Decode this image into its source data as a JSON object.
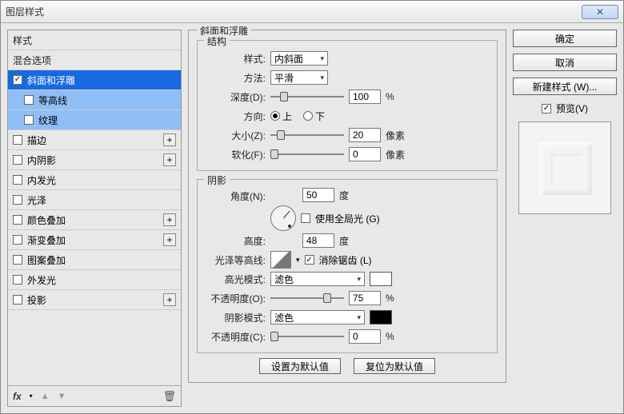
{
  "dialog": {
    "title": "图层样式"
  },
  "left": {
    "header_styles": "样式",
    "header_blending": "混合选项",
    "items": [
      {
        "label": "斜面和浮雕",
        "checked": true,
        "selected": true,
        "plus": false
      },
      {
        "label": "等高线",
        "sub": true,
        "plus": false
      },
      {
        "label": "纹理",
        "sub": true,
        "plus": false
      },
      {
        "label": "描边",
        "plus": true
      },
      {
        "label": "内阴影",
        "plus": true
      },
      {
        "label": "内发光",
        "plus": false
      },
      {
        "label": "光泽",
        "plus": false
      },
      {
        "label": "颜色叠加",
        "plus": true
      },
      {
        "label": "渐变叠加",
        "plus": true
      },
      {
        "label": "图案叠加",
        "plus": false
      },
      {
        "label": "外发光",
        "plus": false
      },
      {
        "label": "投影",
        "plus": true
      }
    ],
    "fx": "fx"
  },
  "main": {
    "group_title": "斜面和浮雕",
    "structure": {
      "legend": "结构",
      "style_label": "样式:",
      "style_value": "内斜面",
      "technique_label": "方法:",
      "technique_value": "平滑",
      "depth_label": "深度(D):",
      "depth_value": "100",
      "depth_unit": "%",
      "direction_label": "方向:",
      "dir_up": "上",
      "dir_down": "下",
      "size_label": "大小(Z):",
      "size_value": "20",
      "size_unit": "像素",
      "soften_label": "软化(F):",
      "soften_value": "0",
      "soften_unit": "像素"
    },
    "shading": {
      "legend": "阴影",
      "angle_label": "角度(N):",
      "angle_value": "50",
      "angle_unit": "度",
      "global_light": "使用全局光 (G)",
      "altitude_label": "高度:",
      "altitude_value": "48",
      "altitude_unit": "度",
      "gloss_label": "光泽等高线:",
      "antialias": "消除锯齿 (L)",
      "hl_mode_label": "高光模式:",
      "hl_mode_value": "滤色",
      "hl_opacity_label": "不透明度(O):",
      "hl_opacity_value": "75",
      "hl_opacity_unit": "%",
      "sh_mode_label": "阴影模式:",
      "sh_mode_value": "滤色",
      "sh_opacity_label": "不透明度(C):",
      "sh_opacity_value": "0",
      "sh_opacity_unit": "%"
    },
    "buttons": {
      "default_set": "设置为默认值",
      "default_reset": "复位为默认值"
    }
  },
  "right": {
    "ok": "确定",
    "cancel": "取消",
    "new_style": "新建样式 (W)...",
    "preview_label": "预览(V)"
  },
  "colors": {
    "hl": "#ffffff",
    "sh": "#000000"
  }
}
